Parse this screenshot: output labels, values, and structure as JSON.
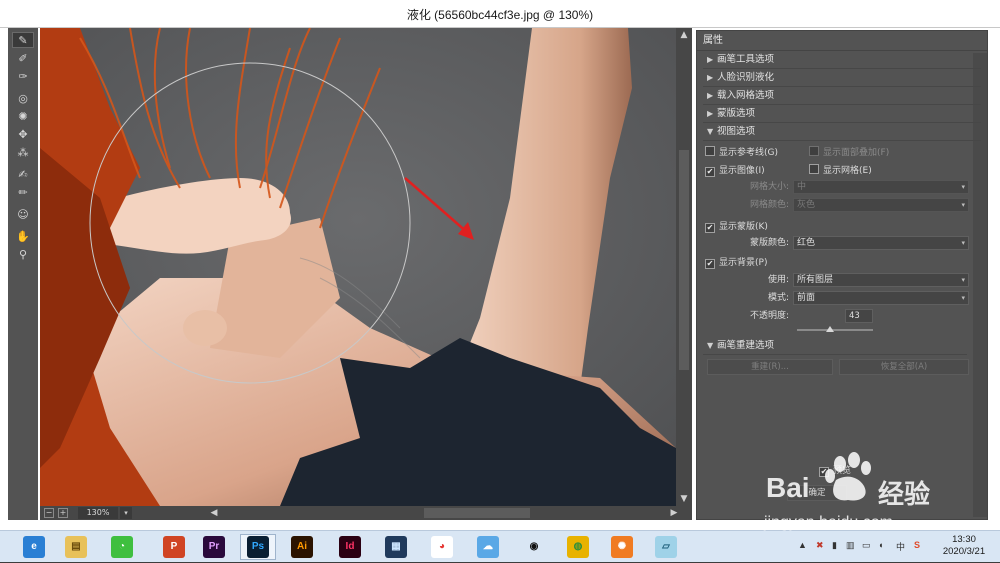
{
  "window": {
    "title": "液化 (56560bc44cf3e.jpg @ 130%)"
  },
  "toolbar": {
    "tools": [
      {
        "name": "forward-warp-tool",
        "glyph": "✎"
      },
      {
        "name": "reconstruct-tool",
        "glyph": "✐"
      },
      {
        "name": "smooth-tool",
        "glyph": "✑"
      },
      {
        "name": "twirl-tool",
        "glyph": "◎"
      },
      {
        "name": "pucker-tool",
        "glyph": "✺"
      },
      {
        "name": "bloat-tool",
        "glyph": "✥"
      },
      {
        "name": "push-left-tool",
        "glyph": "⁂"
      },
      {
        "name": "freeze-mask-tool",
        "glyph": "✍"
      },
      {
        "name": "thaw-mask-tool",
        "glyph": "✏"
      },
      {
        "name": "face-tool",
        "glyph": "☺"
      },
      {
        "name": "hand-tool",
        "glyph": "✋"
      },
      {
        "name": "zoom-tool",
        "glyph": "⚲"
      }
    ]
  },
  "status": {
    "zoom": "130%",
    "zoom_out": "−",
    "zoom_in": "+"
  },
  "panel": {
    "header": "属性",
    "sections": {
      "brush_tool_options": "画笔工具选项",
      "face_aware_liquify": "人脸识别液化",
      "load_mesh_options": "载入网格选项",
      "mask_options": "蒙版选项",
      "view_options": "视图选项",
      "brush_reconstruct_options": "画笔重建选项"
    },
    "view": {
      "show_guides": "显示参考线(G)",
      "show_face_overlay": "显示面部叠加(F)",
      "show_image": "显示图像(I)",
      "show_mesh": "显示网格(E)",
      "mesh_size_label": "网格大小:",
      "mesh_size_value": "中",
      "mesh_color_label": "网格颜色:",
      "mesh_color_value": "灰色",
      "show_mask": "显示蒙版(K)",
      "mask_color_label": "蒙版颜色:",
      "mask_color_value": "红色",
      "show_backdrop": "显示背景(P)",
      "use_label": "使用:",
      "use_value": "所有图层",
      "mode_label": "模式:",
      "mode_value": "前面",
      "opacity_label": "不透明度:",
      "opacity_value": "43",
      "opacity_fraction": 0.43
    },
    "reconstruct": {
      "button": "重建(R)...",
      "restore_all": "恢复全部(A)"
    },
    "preview_label": "预览",
    "ok_label": "确定",
    "check": "✔"
  },
  "taskbar": {
    "apps": [
      {
        "name": "browser-icon",
        "glyph": "e",
        "bg": "#2a7fd4",
        "fg": "#ffffff"
      },
      {
        "name": "file-explorer-icon",
        "glyph": "▤",
        "bg": "#e8c15a",
        "fg": "#6b4c0c"
      },
      {
        "name": "wechat-icon",
        "glyph": "◔",
        "bg": "#3fbf3f",
        "fg": "#ffffff"
      },
      {
        "name": "powerpoint-icon",
        "glyph": "P",
        "bg": "#d04423",
        "fg": "#ffffff"
      },
      {
        "name": "premiere-icon",
        "glyph": "Pr",
        "bg": "#2a0a3c",
        "fg": "#e2a0ff"
      },
      {
        "name": "photoshop-icon",
        "glyph": "Ps",
        "bg": "#0a1f33",
        "fg": "#31a8ff"
      },
      {
        "name": "illustrator-icon",
        "glyph": "Ai",
        "bg": "#2b1300",
        "fg": "#ff9a00"
      },
      {
        "name": "indesign-icon",
        "glyph": "Id",
        "bg": "#2b0012",
        "fg": "#ff3366"
      },
      {
        "name": "video-editor-icon",
        "glyph": "▦",
        "bg": "#203a5c",
        "fg": "#cde6ff"
      },
      {
        "name": "chart-app-icon",
        "glyph": "◕",
        "bg": "#ffffff",
        "fg": "#e53935"
      },
      {
        "name": "cloud-app-icon",
        "glyph": "☁",
        "bg": "#5aa8e6",
        "fg": "#ffffff"
      },
      {
        "name": "qq-icon",
        "glyph": "◉",
        "bg": "#d9e6f4",
        "fg": "#111111"
      },
      {
        "name": "chrome-icon",
        "glyph": "◍",
        "bg": "#e8b200",
        "fg": "#2f8f3a"
      },
      {
        "name": "firefox-icon",
        "glyph": "✺",
        "bg": "#f07b22",
        "fg": "#ffffff"
      },
      {
        "name": "notes-app-icon",
        "glyph": "▱",
        "bg": "#9fd2e8",
        "fg": "#1d5f7a"
      }
    ],
    "tray": {
      "chevron": "▲",
      "ime_lang": "中",
      "sogou": "S"
    },
    "clock": {
      "time": "13:30",
      "date": "2020/3/21"
    }
  },
  "watermark": {
    "brand": "Bai",
    "brand2": "经验",
    "url": "jingyan.baidu.com"
  },
  "colors": {
    "panel_bg": "#535353",
    "canvas_bg": "#5e5f61",
    "arrow_red": "#e02020",
    "hair": "#c94a14"
  }
}
